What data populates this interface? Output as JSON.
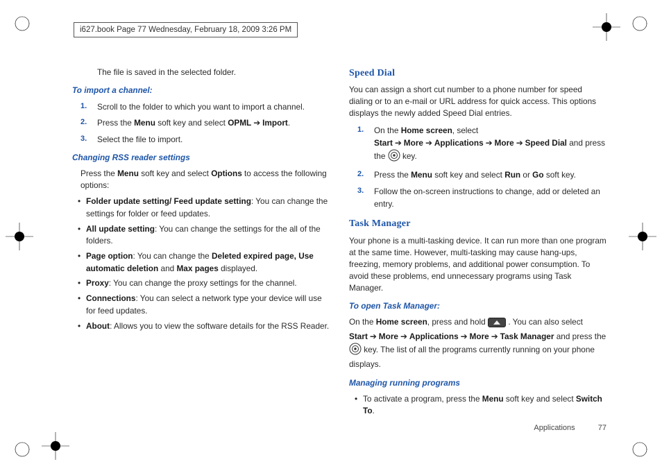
{
  "header": {
    "stamp": "i627.book  Page 77  Wednesday, February 18, 2009  3:26 PM"
  },
  "left": {
    "intro": "The file is saved in the selected folder.",
    "importHead": "To import a channel:",
    "step1": "Scroll to the folder to which you want to import a channel.",
    "step2a": "Press the ",
    "step2b": " soft key and select ",
    "opml": "OPML",
    "import": "Import",
    "step3": "Select the file to import.",
    "rssHead": "Changing RSS reader settings",
    "rssParaA": "Press the ",
    "menu": "Menu",
    "rssParaB": " soft key and select ",
    "options": "Options",
    "rssParaC": " to access the following options:",
    "b1t": "Folder update setting/ Feed update setting",
    "b1": ": You can change the settings for folder or feed updates.",
    "b2t": "All update setting",
    "b2": ": You can change the settings for the all of the folders.",
    "b3t": "Page option",
    "b3a": ": You can change the ",
    "b3b": "Deleted expired page,",
    "b3c": " Use automatic deletion",
    "b3d": " and ",
    "b3e": "Max pages",
    "b3f": " displayed.",
    "b4t": "Proxy",
    "b4": ": You can change the proxy settings for the channel.",
    "b5t": "Connections",
    "b5": ": You can select a network type your device will use for feed updates.",
    "b6t": "About",
    "b6": ": Allows you to view the software details for the RSS Reader."
  },
  "right": {
    "speedHead": "Speed Dial",
    "speedPara": "You can assign a short cut number to a phone number for speed dialing or to an e-mail or URL address for quick access. This options displays the newly added Speed Dial entries.",
    "s1a": "On the ",
    "home": "Home screen",
    "s1b": ", select ",
    "start": "Start",
    "more": "More",
    "apps": "Applications",
    "sd": "Speed Dial",
    "s1c": " and press the ",
    "s1d": " key.",
    "s2a": "Press the ",
    "menu": "Menu",
    "s2b": " soft key and select ",
    "run": "Run",
    "or": " or ",
    "go": "Go",
    "s2c": " soft key.",
    "s3": "Follow the on-screen instructions to change, add or deleted an entry.",
    "tmHead": "Task Manager",
    "tmPara": "Your phone is a multi-tasking device. It can run more than one program at the same time. However, multi-tasking may cause hang-ups, freezing, memory problems, and additional power consumption. To avoid these problems, end unnecessary programs using Task Manager.",
    "openTmHead": "To open Task Manager:",
    "op1": "On the ",
    "op2": ", press and hold ",
    "op3": ". You can also select ",
    "tm": "Task Manager",
    "op4": " and press the ",
    "op5": " key. The list of all the programs currently running on your phone displays.",
    "mrpHead": "Managing running programs",
    "mrpA": "To activate a program, press the ",
    "mrpB": " soft key and select ",
    "switch": "Switch To",
    "mrpC": "."
  },
  "footer": {
    "section": "Applications",
    "page": "77"
  },
  "glyphs": {
    "arrow": "➔"
  }
}
